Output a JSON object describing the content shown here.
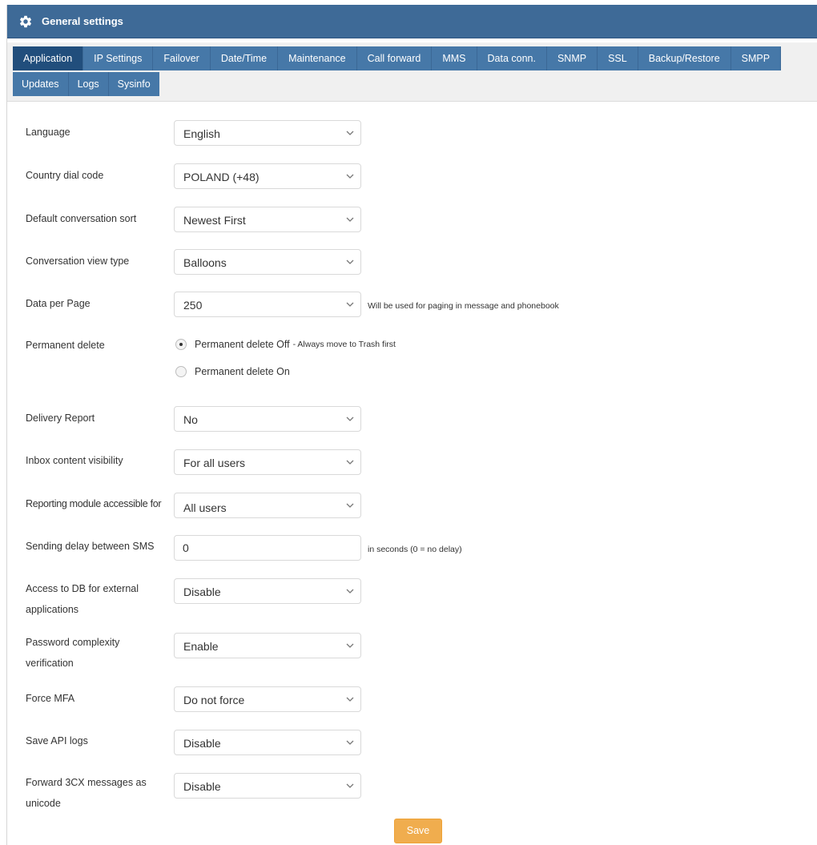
{
  "header": {
    "title": "General settings",
    "icon": "gear-icon"
  },
  "tabs": {
    "row1": [
      "Application",
      "IP Settings",
      "Failover",
      "Date/Time",
      "Maintenance",
      "Call forward",
      "MMS",
      "Data conn.",
      "SNMP",
      "SSL",
      "Backup/Restore",
      "SMPP"
    ],
    "row2": [
      "Updates",
      "Logs",
      "Sysinfo"
    ],
    "active": "Application"
  },
  "colors": {
    "header": "#3e6a97",
    "tab": "#4678a8",
    "tab_active": "#214e7c",
    "save": "#f0ad4e"
  },
  "form": {
    "language": {
      "label": "Language",
      "value": "English"
    },
    "dial_code": {
      "label": "Country dial code",
      "value": "POLAND (+48)"
    },
    "conv_sort": {
      "label": "Default conversation sort",
      "value": "Newest First"
    },
    "conv_view": {
      "label": "Conversation view type",
      "value": "Balloons"
    },
    "per_page": {
      "label": "Data per Page",
      "value": "250",
      "hint": "Will be used for paging in message and phonebook"
    },
    "perm_delete": {
      "label": "Permanent delete",
      "off_label": "Permanent delete Off",
      "off_note": "- Always move to Trash first",
      "on_label": "Permanent delete On",
      "selected": "off"
    },
    "delivery": {
      "label": "Delivery Report",
      "value": "No"
    },
    "inbox": {
      "label": "Inbox content visibility",
      "value": "For all users"
    },
    "reporting": {
      "label": "Reporting module accessible for",
      "value": "All users"
    },
    "delay": {
      "label": "Sending delay between SMS",
      "value": "0",
      "hint": "in seconds (0 = no delay)"
    },
    "db_access": {
      "label_1": "Access to DB for external",
      "label_2": "applications",
      "value": "Disable"
    },
    "pwd": {
      "label_1": "Password complexity",
      "label_2": "verification",
      "value": "Enable"
    },
    "mfa": {
      "label": "Force MFA",
      "value": "Do not force"
    },
    "api_logs": {
      "label": "Save API logs",
      "value": "Disable"
    },
    "unicode": {
      "label_1": "Forward 3CX messages as",
      "label_2": "unicode",
      "value": "Disable"
    }
  },
  "save_label": "Save"
}
